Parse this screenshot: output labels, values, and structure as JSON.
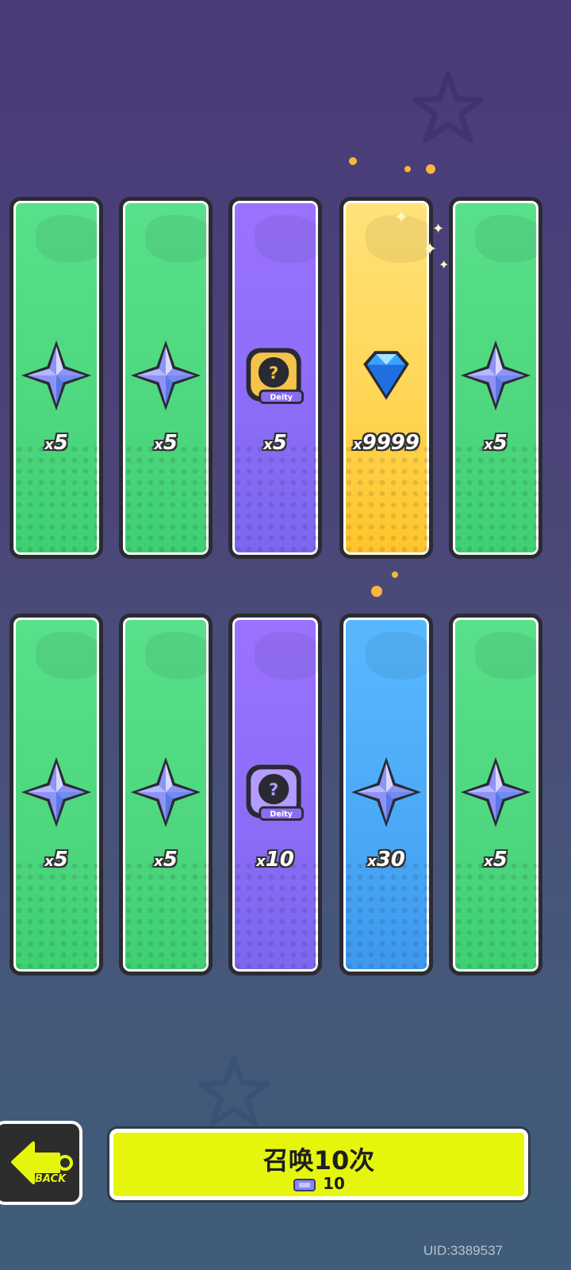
{
  "cards_row1": [
    {
      "color": "green",
      "item": "star-shard-icon",
      "qty": "5"
    },
    {
      "color": "green",
      "item": "star-shard-icon",
      "qty": "5"
    },
    {
      "color": "purple",
      "item": "deity-card-icon",
      "qty": "5"
    },
    {
      "color": "gold",
      "item": "diamond-icon",
      "qty": "9999"
    },
    {
      "color": "green",
      "item": "star-shard-icon",
      "qty": "5"
    }
  ],
  "cards_row2": [
    {
      "color": "green",
      "item": "star-shard-icon",
      "qty": "5"
    },
    {
      "color": "green",
      "item": "star-shard-icon",
      "qty": "5"
    },
    {
      "color": "purple",
      "item": "deity-card-icon",
      "qty": "10"
    },
    {
      "color": "blue",
      "item": "star-shard-icon",
      "qty": "30"
    },
    {
      "color": "green",
      "item": "star-shard-icon",
      "qty": "5"
    }
  ],
  "qty_prefix": "x",
  "deity_label": "Deity",
  "back_label": "BACK",
  "summon": {
    "label": "召唤10次",
    "cost": "10"
  },
  "uid": "UID:3389537",
  "colors": {
    "green": "#4ed77f",
    "purple": "#8b6cf6",
    "gold": "#ffd656",
    "blue": "#4aa9f7",
    "button": "#e5f60c"
  }
}
